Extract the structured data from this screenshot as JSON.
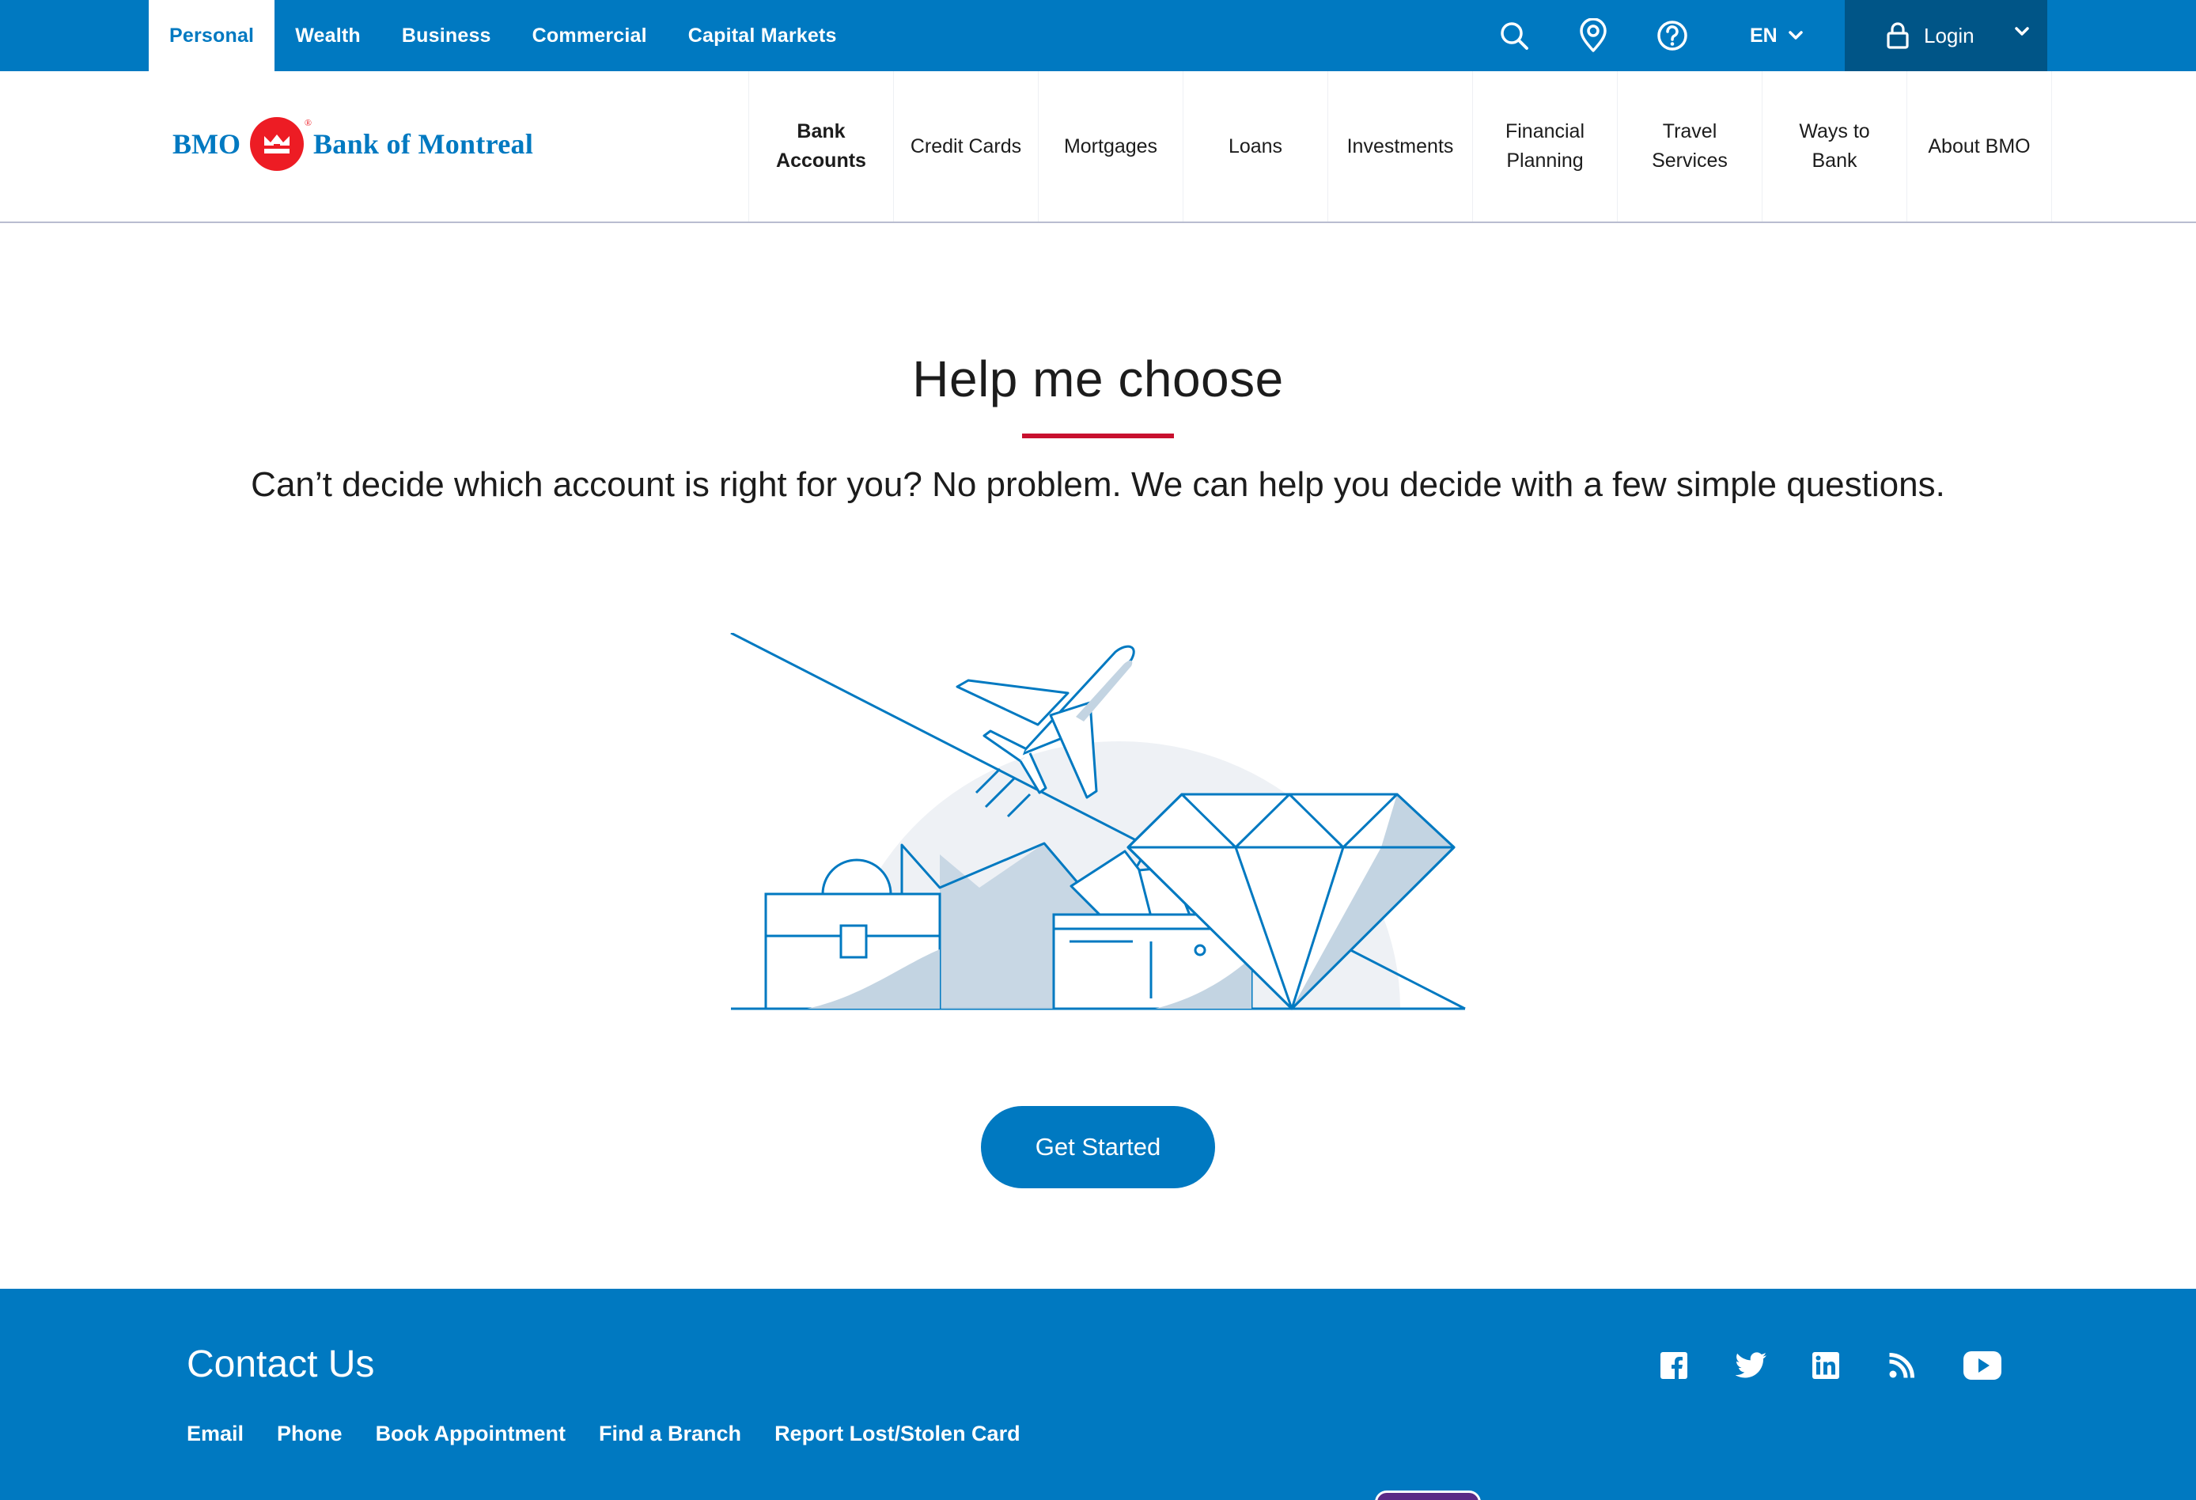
{
  "topbar": {
    "segments": [
      "Personal",
      "Wealth",
      "Business",
      "Commercial",
      "Capital Markets"
    ],
    "language": "EN",
    "login_label": "Login",
    "icons": [
      "search-icon",
      "location-icon",
      "help-icon",
      "lock-icon"
    ]
  },
  "logo": {
    "bmo": "BMO",
    "bank_name": "Bank of Montreal"
  },
  "nav": {
    "items": [
      "Bank\nAccounts",
      "Credit Cards",
      "Mortgages",
      "Loans",
      "Investments",
      "Financial\nPlanning",
      "Travel\nServices",
      "Ways to\nBank",
      "About BMO"
    ]
  },
  "main": {
    "title": "Help me choose",
    "subtitle": "Can’t decide which account is right for you? No problem. We can help you decide with a few simple questions.",
    "cta_label": "Get Started"
  },
  "footer": {
    "title": "Contact Us",
    "links": [
      "Email",
      "Phone",
      "Book Appointment",
      "Find a Branch",
      "Report Lost/Stolen Card"
    ],
    "social_icons": [
      "facebook-icon",
      "twitter-icon",
      "linkedin-icon",
      "rss-icon",
      "youtube-icon"
    ]
  },
  "colors": {
    "brand_blue": "#0079c1",
    "login_blue": "#005587",
    "accent_red": "#c8102e",
    "logo_red": "#ed1c24"
  }
}
